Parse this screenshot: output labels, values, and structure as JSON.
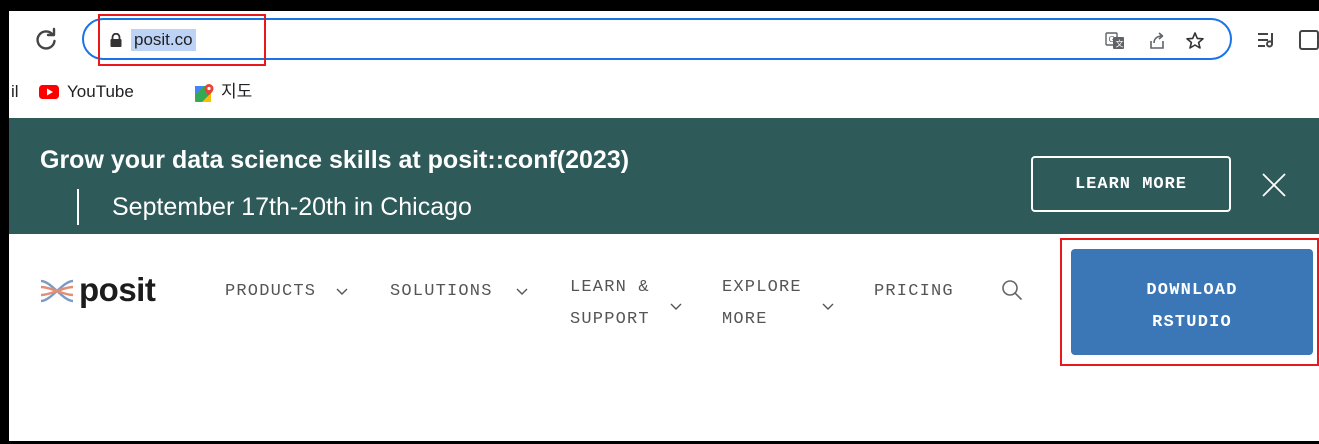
{
  "browser": {
    "url": "posit.co"
  },
  "bookmarks": [
    {
      "label": "il",
      "icon": "gmail-icon"
    },
    {
      "label": "YouTube",
      "icon": "youtube-icon"
    },
    {
      "label": "지도",
      "icon": "google-maps-icon"
    }
  ],
  "banner": {
    "title": "Grow your data science skills at posit::conf(2023)",
    "subtitle": "September 17th-20th in Chicago",
    "button_label": "LEARN MORE"
  },
  "site_nav": {
    "logo_text": "posit",
    "items": [
      {
        "line1": "PRODUCTS",
        "line2": ""
      },
      {
        "line1": "SOLUTIONS",
        "line2": ""
      },
      {
        "line1": "LEARN &",
        "line2": "SUPPORT"
      },
      {
        "line1": "EXPLORE",
        "line2": "MORE"
      },
      {
        "line1": "PRICING",
        "line2": ""
      }
    ],
    "download": {
      "line1": "DOWNLOAD",
      "line2": "RSTUDIO"
    }
  },
  "colors": {
    "banner_bg": "#2e5a59",
    "download_bg": "#3b77b6",
    "focus_ring": "#1a73e8",
    "annotation_red": "#e8191b"
  }
}
